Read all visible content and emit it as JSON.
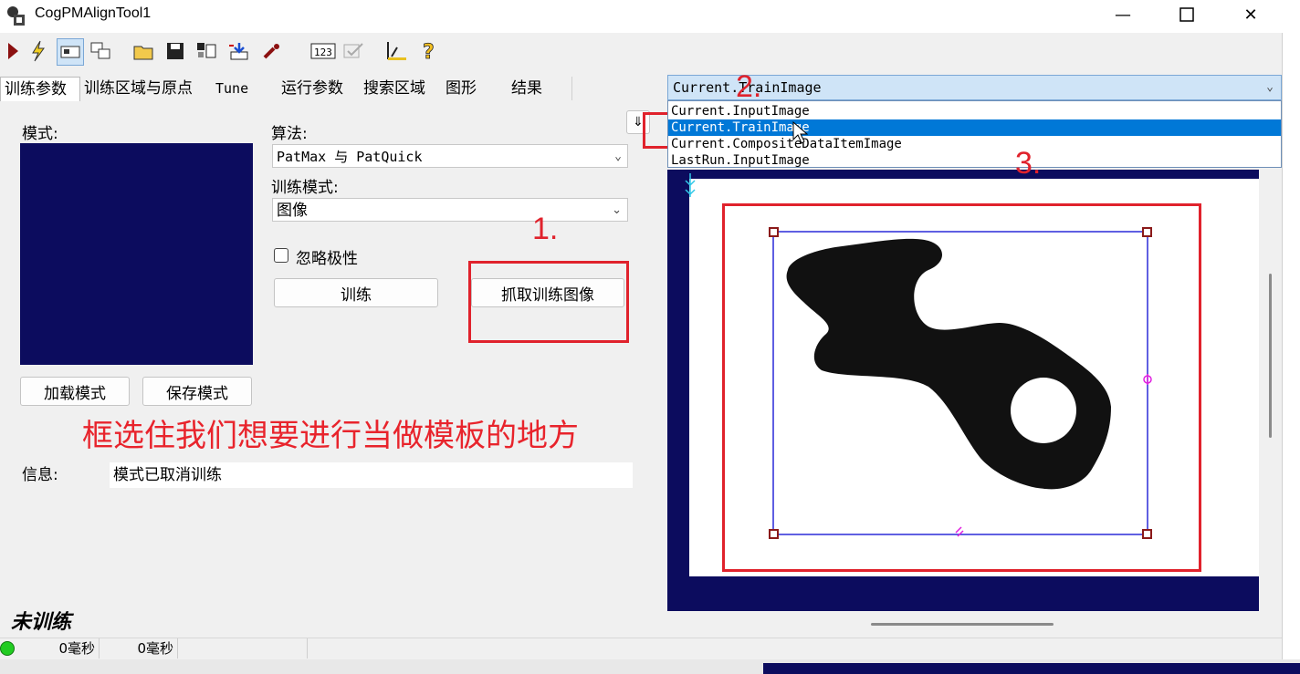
{
  "window": {
    "title": "CogPMAlignTool1"
  },
  "tabs": [
    {
      "label": "训练参数"
    },
    {
      "label": "训练区域与原点"
    },
    {
      "label": "Tune"
    },
    {
      "label": "运行参数"
    },
    {
      "label": "搜索区域"
    },
    {
      "label": "图形"
    },
    {
      "label": "结果"
    }
  ],
  "train_params": {
    "pattern_label": "模式:",
    "algorithm_label": "算法:",
    "algorithm_value": "PatMax 与 PatQuick",
    "train_mode_label": "训练模式:",
    "train_mode_value": "图像",
    "ignore_polarity_label": "忽略极性",
    "train_button": "训练",
    "grab_button": "抓取训练图像",
    "load_button": "加载模式",
    "save_button": "保存模式",
    "info_label": "信息:",
    "info_value": "模式已取消训练",
    "trained_status": "未训练"
  },
  "image_selector": {
    "selected": "Current.TrainImage",
    "options": [
      {
        "label": "Current.InputImage"
      },
      {
        "label": "Current.TrainImage"
      },
      {
        "label": "Current.CompositeDataItemImage"
      },
      {
        "label": "LastRun.InputImage"
      }
    ]
  },
  "annotations": {
    "note": "框选住我们想要进行当做模板的地方",
    "step1": "1.",
    "step2": "2.",
    "step3": "3."
  },
  "statusbar": {
    "time1": "0毫秒",
    "time2": "0毫秒",
    "status_color": "#22cc22"
  }
}
